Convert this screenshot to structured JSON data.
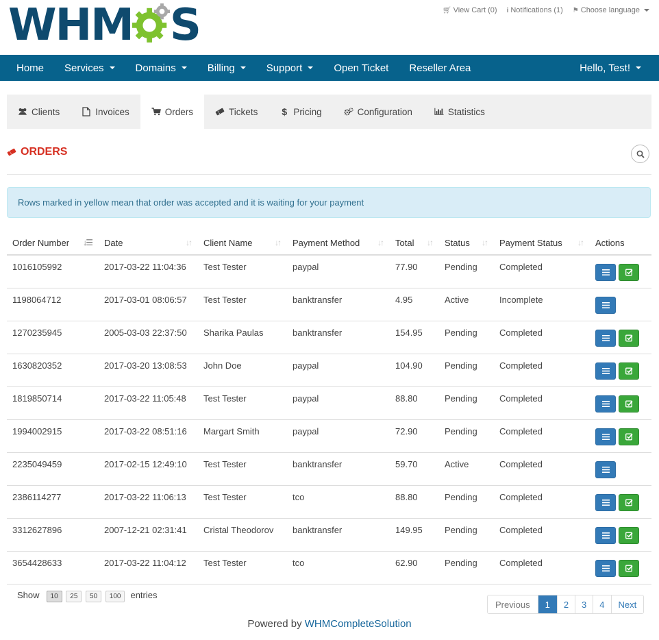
{
  "brand": {
    "logo_left": "WHM",
    "logo_right": "S",
    "colors": {
      "dark": "#0f4a6e",
      "green": "#7ec22f",
      "grey": "#a8a8a8"
    }
  },
  "toplinks": [
    {
      "icon": "cart-icon",
      "label": "View Cart (0)"
    },
    {
      "icon": "info-icon",
      "label": "Notifications (1)"
    },
    {
      "icon": "language-icon",
      "label": "Choose language"
    }
  ],
  "navbar": {
    "items": [
      {
        "label": "Home",
        "dropdown": false
      },
      {
        "label": "Services",
        "dropdown": true
      },
      {
        "label": "Domains",
        "dropdown": true
      },
      {
        "label": "Billing",
        "dropdown": true
      },
      {
        "label": "Support",
        "dropdown": true
      },
      {
        "label": "Open Ticket",
        "dropdown": false
      },
      {
        "label": "Reseller Area",
        "dropdown": false
      }
    ],
    "user": "Hello, Test!",
    "color": "#07628c"
  },
  "tabs": [
    {
      "label": "Clients",
      "icon": "users-icon"
    },
    {
      "label": "Invoices",
      "icon": "file-icon"
    },
    {
      "label": "Orders",
      "icon": "cart-icon"
    },
    {
      "label": "Tickets",
      "icon": "ticket-icon"
    },
    {
      "label": "Pricing",
      "icon": "dollar-icon"
    },
    {
      "label": "Configuration",
      "icon": "cogs-icon"
    },
    {
      "label": "Statistics",
      "icon": "bar-chart-icon"
    }
  ],
  "active_tab": "Orders",
  "page": {
    "title": "ORDERS"
  },
  "alert": "Rows marked in yellow mean that order was accepted and it is waiting for your payment",
  "table": {
    "columns": [
      "Order Number",
      "Date",
      "Client Name",
      "Payment Method",
      "Total",
      "Status",
      "Payment Status",
      "Actions"
    ],
    "rows": [
      {
        "order": "1016105992",
        "date": "2017-03-22 11:04:36",
        "client": "Test Tester",
        "method": "paypal",
        "total": "77.90",
        "status": "Pending",
        "payment": "Completed",
        "accept": true
      },
      {
        "order": "1198064712",
        "date": "2017-03-01 08:06:57",
        "client": "Test Tester",
        "method": "banktransfer",
        "total": "4.95",
        "status": "Active",
        "payment": "Incomplete",
        "accept": false
      },
      {
        "order": "1270235945",
        "date": "2005-03-03 22:37:50",
        "client": "Sharika Paulas",
        "method": "banktransfer",
        "total": "154.95",
        "status": "Pending",
        "payment": "Completed",
        "accept": true
      },
      {
        "order": "1630820352",
        "date": "2017-03-20 13:08:53",
        "client": "John Doe",
        "method": "paypal",
        "total": "104.90",
        "status": "Pending",
        "payment": "Completed",
        "accept": true
      },
      {
        "order": "1819850714",
        "date": "2017-03-22 11:05:48",
        "client": "Test Tester",
        "method": "paypal",
        "total": "88.80",
        "status": "Pending",
        "payment": "Completed",
        "accept": true
      },
      {
        "order": "1994002915",
        "date": "2017-03-22 08:51:16",
        "client": "Margart Smith",
        "method": "paypal",
        "total": "72.90",
        "status": "Pending",
        "payment": "Completed",
        "accept": true
      },
      {
        "order": "2235049459",
        "date": "2017-02-15 12:49:10",
        "client": "Test Tester",
        "method": "banktransfer",
        "total": "59.70",
        "status": "Active",
        "payment": "Completed",
        "accept": false
      },
      {
        "order": "2386114277",
        "date": "2017-03-22 11:06:13",
        "client": "Test Tester",
        "method": "tco",
        "total": "88.80",
        "status": "Pending",
        "payment": "Completed",
        "accept": true
      },
      {
        "order": "3312627896",
        "date": "2007-12-21 02:31:41",
        "client": "Cristal Theodorov",
        "method": "banktransfer",
        "total": "149.95",
        "status": "Pending",
        "payment": "Completed",
        "accept": true
      },
      {
        "order": "3654428633",
        "date": "2017-03-22 11:04:12",
        "client": "Test Tester",
        "method": "tco",
        "total": "62.90",
        "status": "Pending",
        "payment": "Completed",
        "accept": true
      }
    ]
  },
  "length_menu": {
    "prefix": "Show",
    "options": [
      "10",
      "25",
      "50",
      "100"
    ],
    "selected": "10",
    "suffix": "entries"
  },
  "pagination": {
    "previous": "Previous",
    "pages": [
      "1",
      "2",
      "3",
      "4"
    ],
    "current": "1",
    "next": "Next"
  },
  "footer": {
    "prefix": "Powered by",
    "link": "WHMCompleteSolution"
  }
}
